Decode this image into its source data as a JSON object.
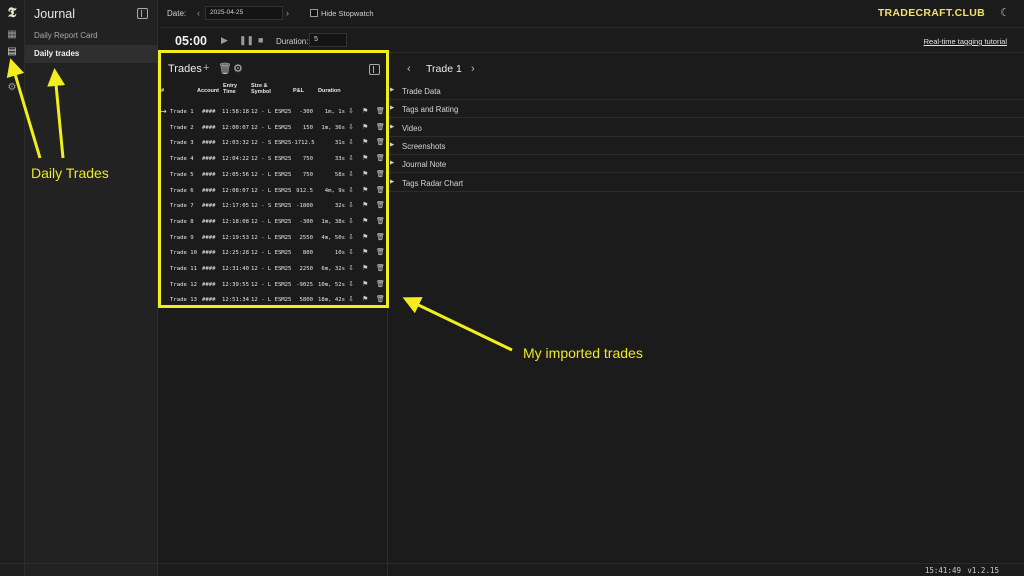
{
  "colors": {
    "brand": "#f1e06a",
    "annotation": "#f2ee1e",
    "background": "#1b1b1b",
    "sidebar_active": "#2f2f2f"
  },
  "rail": {
    "icons": [
      "logo-icon",
      "dashboard-icon",
      "journal-icon",
      "book-icon",
      "settings-icon"
    ]
  },
  "sidebar": {
    "title": "Journal",
    "items": [
      {
        "label": "Daily Report Card"
      },
      {
        "label": "Daily trades"
      }
    ]
  },
  "topbar": {
    "date_label": "Date:",
    "date_value": "2025-04-25",
    "hide_stopwatch_label": "Hide Stopwatch",
    "brand": "TRADECRAFT.CLUB"
  },
  "stopwatch": {
    "time": "05:00",
    "duration_label": "Duration:",
    "duration_value": "5",
    "tutorial_link": "Real-time tagging tutorial"
  },
  "trades_panel": {
    "title": "Trades",
    "columns": [
      "#",
      "Account",
      "Entry Time",
      "Size & Symbol",
      "P&L",
      "Duration"
    ],
    "rows": [
      {
        "name": "Trade 1",
        "account": "####",
        "entry": "11:58:18",
        "size_symbol": "12 - L ESM25",
        "pnl": "-300",
        "duration": "1m, 1s"
      },
      {
        "name": "Trade 2",
        "account": "####",
        "entry": "12:00:07",
        "size_symbol": "12 - L ESM25",
        "pnl": "150",
        "duration": "1m, 36s"
      },
      {
        "name": "Trade 3",
        "account": "####",
        "entry": "12:03:32",
        "size_symbol": "12 - S ESM25",
        "pnl": "-1712.5",
        "duration": "31s"
      },
      {
        "name": "Trade 4",
        "account": "####",
        "entry": "12:04:22",
        "size_symbol": "12 - S ESM25",
        "pnl": "750",
        "duration": "33s"
      },
      {
        "name": "Trade 5",
        "account": "####",
        "entry": "12:05:56",
        "size_symbol": "12 - L ESM25",
        "pnl": "750",
        "duration": "58s"
      },
      {
        "name": "Trade 6",
        "account": "####",
        "entry": "12:08:07",
        "size_symbol": "12 - L ESM25",
        "pnl": "912.5",
        "duration": "4m, 9s"
      },
      {
        "name": "Trade 7",
        "account": "####",
        "entry": "12:17:05",
        "size_symbol": "12 - S ESM25",
        "pnl": "-1800",
        "duration": "32s"
      },
      {
        "name": "Trade 8",
        "account": "####",
        "entry": "12:18:08",
        "size_symbol": "12 - L ESM25",
        "pnl": "-300",
        "duration": "1m, 38s"
      },
      {
        "name": "Trade 9",
        "account": "####",
        "entry": "12:19:53",
        "size_symbol": "12 - L ESM25",
        "pnl": "2550",
        "duration": "4m, 50s"
      },
      {
        "name": "Trade 10",
        "account": "####",
        "entry": "12:25:28",
        "size_symbol": "12 - L ESM25",
        "pnl": "800",
        "duration": "10s"
      },
      {
        "name": "Trade 11",
        "account": "####",
        "entry": "12:31:40",
        "size_symbol": "12 - L ESM25",
        "pnl": "2250",
        "duration": "6m, 32s"
      },
      {
        "name": "Trade 12",
        "account": "####",
        "entry": "12:39:55",
        "size_symbol": "12 - L ESM25",
        "pnl": "-9025",
        "duration": "10m, 52s"
      },
      {
        "name": "Trade 13",
        "account": "####",
        "entry": "12:51:34",
        "size_symbol": "12 - L ESM25",
        "pnl": "5800",
        "duration": "18m, 42s"
      }
    ]
  },
  "detail": {
    "title": "Trade 1",
    "sections": [
      "Trade Data",
      "Tags and Rating",
      "Video",
      "Screenshots",
      "Journal Note",
      "Tags Radar Chart"
    ]
  },
  "status": {
    "clock": "15:41:49",
    "version": "v1.2.15"
  },
  "annotations": {
    "daily_trades": "Daily Trades",
    "imported_trades": "My imported trades"
  }
}
